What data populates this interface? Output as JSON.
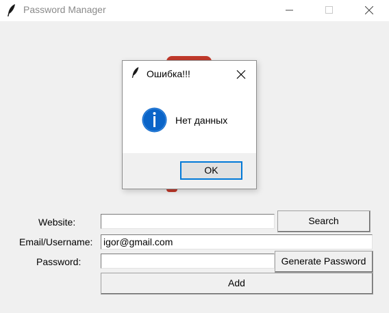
{
  "window": {
    "title": "Password Manager",
    "icon": "feather-icon",
    "controls": [
      "minimize-icon",
      "maximize-icon",
      "close-icon"
    ]
  },
  "form": {
    "website_label": "Website:",
    "website_value": "",
    "email_label": "Email/Username:",
    "email_value": "igor@gmail.com",
    "password_label": "Password:",
    "password_value": "",
    "search_button": "Search",
    "generate_button": "Generate Password",
    "add_button": "Add"
  },
  "dialog": {
    "title": "Ошибка!!!",
    "message": "Нет данных",
    "ok_button": "OK",
    "icon": "info-icon"
  },
  "colors": {
    "logo_accent": "#c0392b",
    "info_icon": "#0a64c8",
    "focus_border": "#0078d7"
  }
}
